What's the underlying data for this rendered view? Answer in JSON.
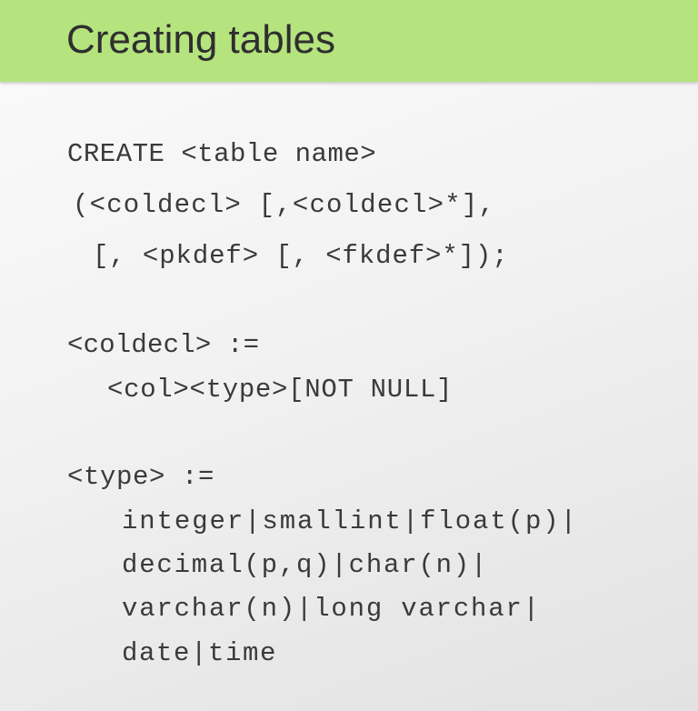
{
  "slide": {
    "title": "Creating tables",
    "code_lines": [
      "CREATE <table name>",
      "(<coldecl> [,<coldecl>*],",
      "[, <pkdef> [, <fkdef>*]);",
      "<coldecl> :=",
      "<col><type>[NOT NULL]",
      "<type> :=",
      "integer|smallint|float(p)|",
      "decimal(p,q)|char(n)|",
      "varchar(n)|long varchar|",
      "date|time"
    ]
  },
  "colors": {
    "header_background": "#b5e47e",
    "title_text": "#2f2f2f",
    "code_text": "#3a3a3a"
  }
}
